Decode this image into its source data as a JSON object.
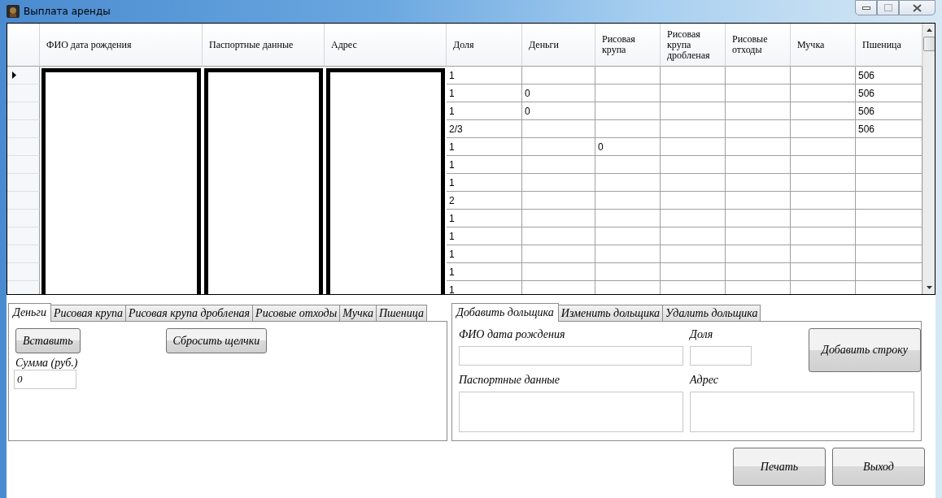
{
  "window": {
    "title": "Выплата аренды"
  },
  "table": {
    "columns": [
      "ФИО дата рождения",
      "Паспортные данные",
      "Адрес",
      "Доля",
      "Деньги",
      "Рисовая крупа",
      "Рисовая крупа дробленая",
      "Рисовые отходы",
      "Мучка",
      "Пшеница"
    ],
    "rows": [
      {
        "current": true,
        "cells": [
          "1",
          "",
          "",
          "",
          "",
          "",
          "506"
        ]
      },
      {
        "current": false,
        "cells": [
          "1",
          "0",
          "",
          "",
          "",
          "",
          "506"
        ]
      },
      {
        "current": false,
        "cells": [
          "1",
          "0",
          "",
          "",
          "",
          "",
          "506"
        ]
      },
      {
        "current": false,
        "cells": [
          "2/3",
          "",
          "",
          "",
          "",
          "",
          "506"
        ]
      },
      {
        "current": false,
        "cells": [
          "1",
          "",
          "0",
          "",
          "",
          "",
          ""
        ]
      },
      {
        "current": false,
        "cells": [
          "1",
          "",
          "",
          "",
          "",
          "",
          ""
        ]
      },
      {
        "current": false,
        "cells": [
          "1",
          "",
          "",
          "",
          "",
          "",
          ""
        ]
      },
      {
        "current": false,
        "cells": [
          "2",
          "",
          "",
          "",
          "",
          "",
          ""
        ]
      },
      {
        "current": false,
        "cells": [
          "1",
          "",
          "",
          "",
          "",
          "",
          ""
        ]
      },
      {
        "current": false,
        "cells": [
          "1",
          "",
          "",
          "",
          "",
          "",
          ""
        ]
      },
      {
        "current": false,
        "cells": [
          "1",
          "",
          "",
          "",
          "",
          "",
          ""
        ]
      },
      {
        "current": false,
        "cells": [
          "1",
          "",
          "",
          "",
          "",
          "",
          ""
        ]
      },
      {
        "current": false,
        "cells": [
          "1",
          "",
          "",
          "",
          "",
          "",
          ""
        ]
      }
    ]
  },
  "left_tabs": [
    {
      "label": "Деньги",
      "selected": true
    },
    {
      "label": "Рисовая крупа",
      "selected": false
    },
    {
      "label": "Рисовая крупа дробленая",
      "selected": false
    },
    {
      "label": "Рисовые отходы",
      "selected": false
    },
    {
      "label": "Мучка",
      "selected": false
    },
    {
      "label": "Пшеница",
      "selected": false
    }
  ],
  "money_panel": {
    "insert_button": "Вставить",
    "reset_button": "Сбросить щелчки",
    "sum_label": "Сумма (руб.)",
    "sum_value": "0"
  },
  "right_tabs": [
    {
      "label": "Добавить дольщика",
      "selected": true
    },
    {
      "label": "Изменить дольщика",
      "selected": false
    },
    {
      "label": "Удалить дольщика",
      "selected": false
    }
  ],
  "add_form": {
    "name_label": "ФИО дата рождения",
    "share_label": "Доля",
    "passport_label": "Паспортные данные",
    "address_label": "Адрес",
    "add_button": "Добавить строку"
  },
  "buttons": [
    "Печать",
    "Выход"
  ]
}
